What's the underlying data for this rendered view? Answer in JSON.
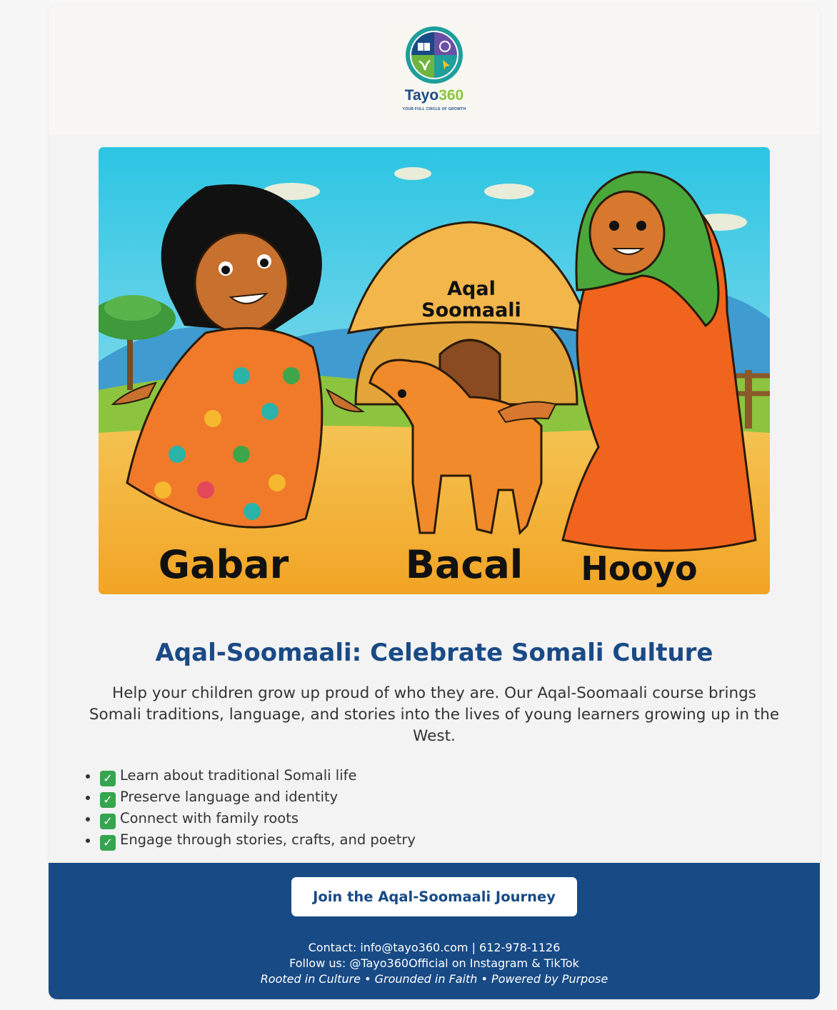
{
  "brand": {
    "name_part1": "Tayo",
    "name_part2": "360",
    "tagline": "YOUR FULL CIRCLE OF GROWTH"
  },
  "hero": {
    "labels": {
      "hut": "Aqal",
      "hut_line2": "Soomaali",
      "girl": "Gabar",
      "goat": "Bacal",
      "mother": "Hooyo"
    }
  },
  "main": {
    "title": "Aqal-Soomaali: Celebrate Somali Culture",
    "intro_line1": "Help your children grow up proud of who they are. Our Aqal-Soomaali course brings",
    "intro_line2": "Somali traditions, language, and stories into the lives of young learners growing up in the",
    "intro_line3": "West.",
    "features": [
      "Learn about traditional Somali life",
      "Preserve language and identity",
      "Connect with family roots",
      "Engage through stories, crafts, and poetry"
    ]
  },
  "footer": {
    "cta_label": "Join the Aqal-Soomaali Journey",
    "contact_line": "Contact: info@tayo360.com | 612-978-1126",
    "follow_line": "Follow us: @Tayo360Official on Instagram & TikTok",
    "tagline": "Rooted in Culture • Grounded in Faith • Powered by Purpose"
  },
  "colors": {
    "brand_blue": "#184a86",
    "brand_green": "#8cc43f",
    "check_green": "#35a54f"
  }
}
